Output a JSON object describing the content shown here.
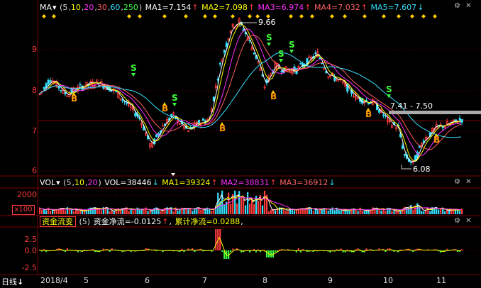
{
  "main": {
    "indicator": "MA",
    "params": [
      "5",
      "10",
      "20",
      "30",
      "60",
      "250"
    ],
    "ma1": "MA1=7.154",
    "ma2": "MA2=7.098",
    "ma3": "MA3=6.974",
    "ma4": "MA4=7.032",
    "ma5": "MA5=7.607",
    "y_ticks": [
      "9",
      "8",
      "7",
      "6"
    ],
    "high_label": "9.66",
    "low_label": "6.08",
    "range_label": "7.41 - 7.50",
    "signals": {
      "buy": "B",
      "sell": "S"
    }
  },
  "vol": {
    "indicator": "VOL",
    "params": [
      "5",
      "10",
      "20"
    ],
    "vol": "VOL=38446",
    "ma1": "MA1=39324",
    "ma2": "MA2=38831",
    "ma3": "MA3=36912",
    "y_tick": "2000",
    "unit": "x100"
  },
  "fund": {
    "indicator": "资金流变",
    "param": "(5)",
    "net": "资金净流=-0.0125",
    "cum": "累计净流=0.0288",
    "y_ticks": [
      "2.5",
      "0.0",
      "-2.5"
    ]
  },
  "xaxis": {
    "period": "日线",
    "labels": [
      "2018/4",
      "5",
      "6",
      "7",
      "8",
      "9",
      "10",
      "11"
    ]
  },
  "colors": {
    "up": "#ff3b3b",
    "down": "#35e0ff",
    "grid": "#7a0000",
    "ma1": "#ffffff",
    "ma2": "#ffff00",
    "ma3": "#ff2dff",
    "ma4": "#ff6060",
    "ma5": "#35e0ff"
  }
}
